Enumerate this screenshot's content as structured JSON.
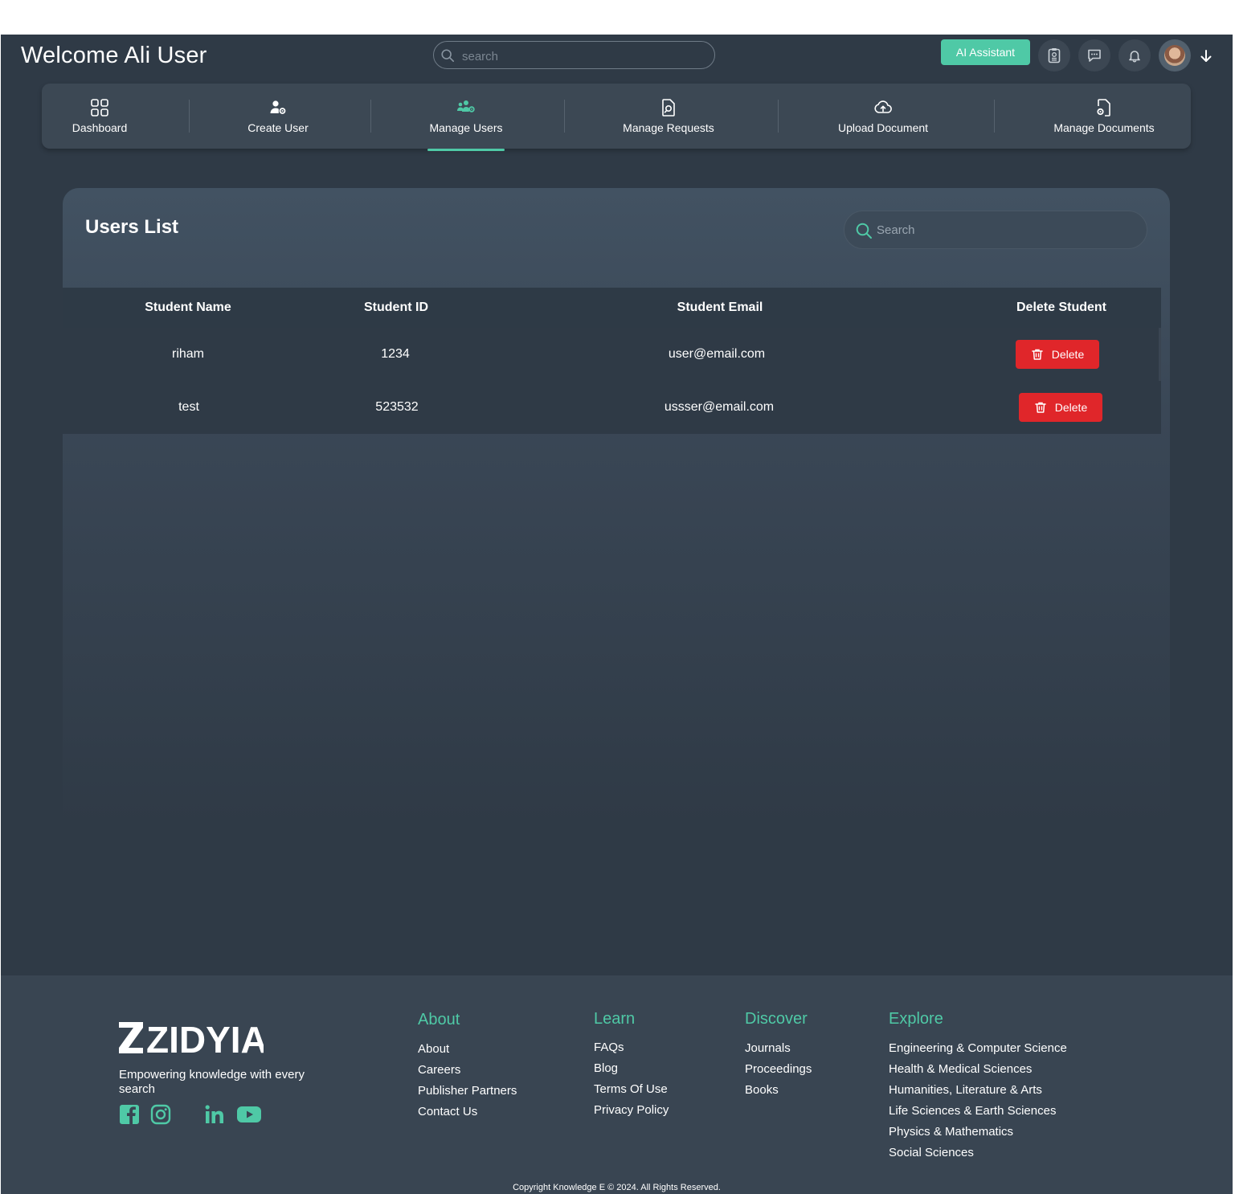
{
  "header": {
    "welcome": "Welcome Ali User",
    "search_placeholder": "search",
    "ai_assistant_label": "AI Assistant"
  },
  "nav": {
    "items": [
      {
        "label": "Dashboard",
        "icon": "grid-icon"
      },
      {
        "label": "Create User",
        "icon": "user-gear-icon"
      },
      {
        "label": "Manage Users",
        "icon": "users-gear-icon",
        "active": true
      },
      {
        "label": "Manage Requests",
        "icon": "document-search-icon"
      },
      {
        "label": "Upload Document",
        "icon": "cloud-upload-icon"
      },
      {
        "label": "Manage Documents",
        "icon": "document-gear-icon"
      }
    ]
  },
  "users_list": {
    "title": "Users List",
    "search_placeholder": "Search",
    "columns": [
      "Student Name",
      "Student ID",
      "Student Email",
      "Delete Student"
    ],
    "rows": [
      {
        "name": "riham",
        "id": "1234",
        "email": "user@email.com",
        "action": "Delete"
      },
      {
        "name": "test",
        "id": "523532",
        "email": "ussser@email.com",
        "action": "Delete"
      }
    ]
  },
  "footer": {
    "brand": "ZIDYIA",
    "tagline": "Empowering knowledge with every search",
    "about": {
      "heading": "About",
      "links": [
        "About",
        "Careers",
        "Publisher Partners",
        "Contact Us"
      ]
    },
    "learn": {
      "heading": "Learn",
      "links": [
        "FAQs",
        "Blog",
        "Terms Of Use",
        "Privacy Policy"
      ]
    },
    "discover": {
      "heading": "Discover",
      "links": [
        "Journals",
        "Proceedings",
        "Books"
      ]
    },
    "explore": {
      "heading": "Explore",
      "links": [
        "Engineering & Computer Science",
        "Health & Medical Sciences",
        "Humanities, Literature & Arts",
        "Life Sciences & Earth Sciences",
        "Physics & Mathematics",
        "Social Sciences"
      ]
    },
    "copyright": "Copyright Knowledge E © 2024. All Rights Reserved."
  },
  "colors": {
    "accent": "#4fc9a6",
    "danger": "#e0262a",
    "background": "#2f3a46",
    "footer": "#394552"
  }
}
